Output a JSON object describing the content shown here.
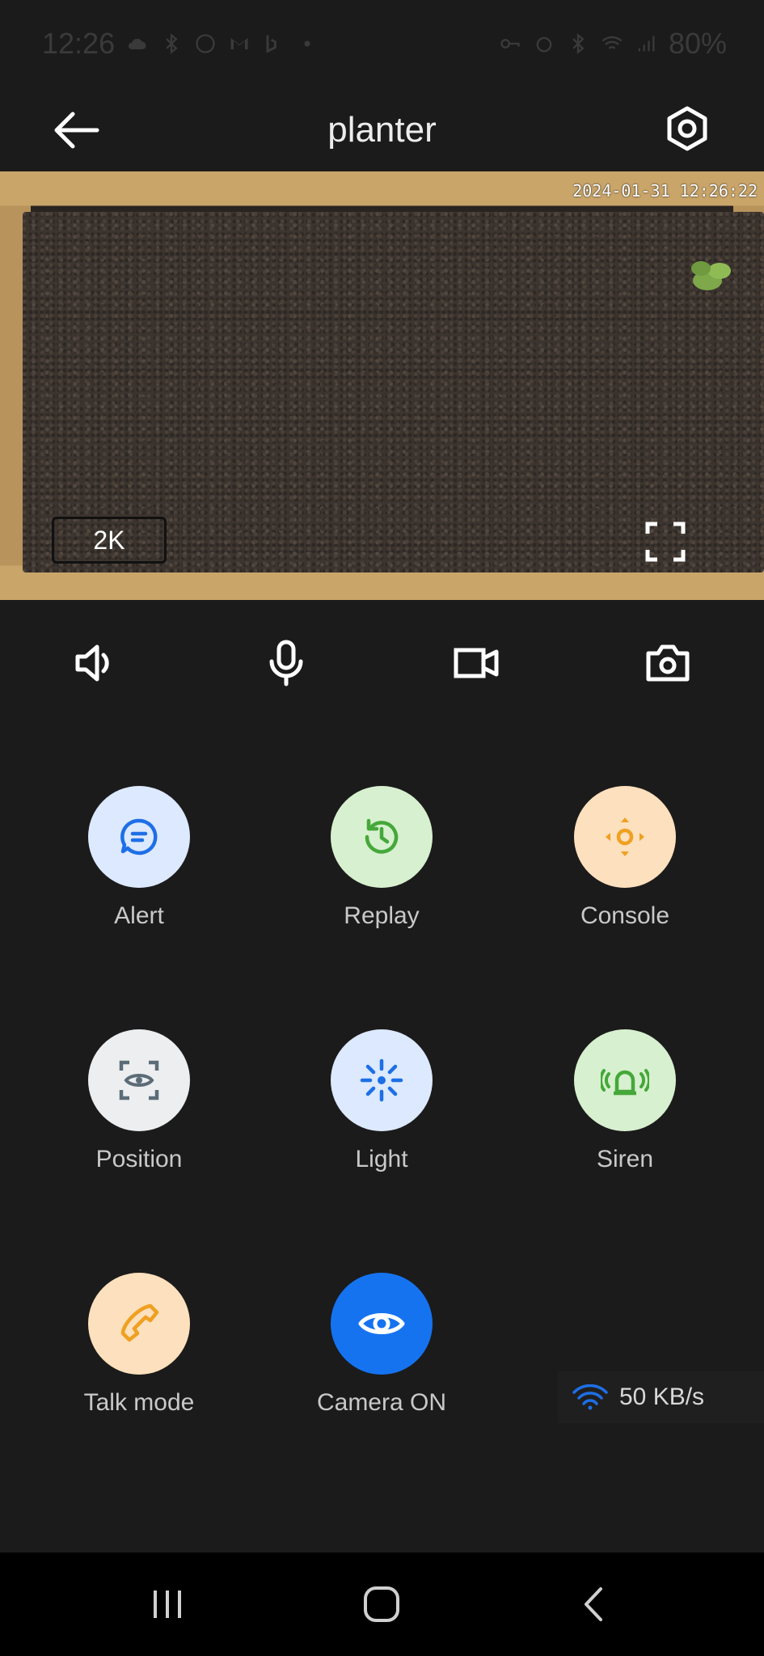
{
  "status_bar": {
    "time": "12:26",
    "battery": "80%"
  },
  "app_bar": {
    "title": "planter",
    "back_icon": "arrow-left-icon",
    "settings_icon": "gear-icon"
  },
  "video": {
    "timestamp": "2024-01-31  12:26:22",
    "quality_label": "2K",
    "fullscreen_icon": "fullscreen-icon"
  },
  "controls": [
    {
      "name": "speaker",
      "icon": "speaker-icon"
    },
    {
      "name": "microphone",
      "icon": "microphone-icon"
    },
    {
      "name": "record",
      "icon": "video-camera-icon"
    },
    {
      "name": "snapshot",
      "icon": "camera-icon"
    }
  ],
  "actions": [
    {
      "label": "Alert",
      "icon": "message-icon",
      "bg": "#dce9ff",
      "fg": "#1e6fe6"
    },
    {
      "label": "Replay",
      "icon": "history-icon",
      "bg": "#d7f0cf",
      "fg": "#45a83a"
    },
    {
      "label": "Console",
      "icon": "direction-pad-icon",
      "bg": "#fde0bd",
      "fg": "#f0a020"
    },
    {
      "label": "Position",
      "icon": "eye-focus-icon",
      "bg": "#eceeef",
      "fg": "#5b6c78"
    },
    {
      "label": "Light",
      "icon": "light-icon",
      "bg": "#dce9ff",
      "fg": "#1e6fe6"
    },
    {
      "label": "Siren",
      "icon": "siren-icon",
      "bg": "#d7f0cf",
      "fg": "#45a83a"
    },
    {
      "label": "Talk mode",
      "icon": "phone-icon",
      "bg": "#fde0bd",
      "fg": "#f0a020"
    },
    {
      "label": "Camera ON",
      "icon": "eye-icon",
      "bg": "#1573f0",
      "fg": "#ffffff"
    }
  ],
  "network": {
    "speed": "50 KB/s",
    "icon": "wifi-icon"
  },
  "nav_bar": {
    "recents_icon": "recents-icon",
    "home_icon": "home-icon",
    "back_icon": "back-chevron-icon"
  }
}
